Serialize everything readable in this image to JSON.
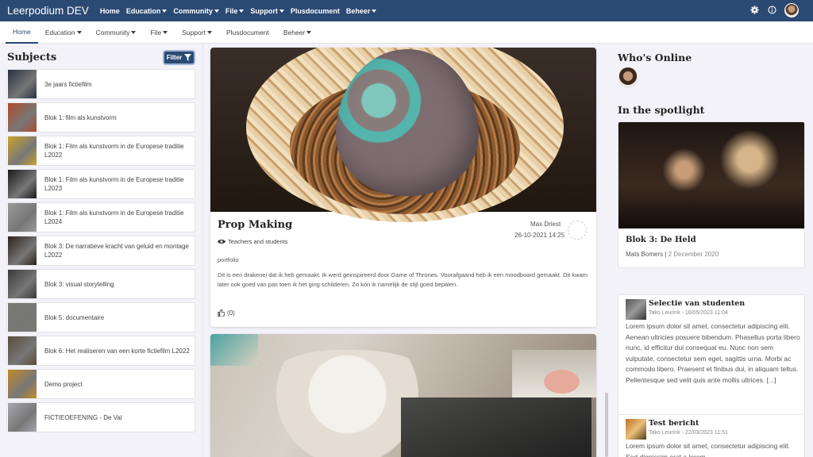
{
  "app": {
    "title": "Leerpodium DEV"
  },
  "topnav": {
    "items": [
      {
        "label": "Home",
        "has_caret": false
      },
      {
        "label": "Education",
        "has_caret": true
      },
      {
        "label": "Community",
        "has_caret": true
      },
      {
        "label": "File",
        "has_caret": true
      },
      {
        "label": "Support",
        "has_caret": true
      },
      {
        "label": "Plusdocument",
        "has_caret": false
      },
      {
        "label": "Beheer",
        "has_caret": true
      }
    ],
    "icons": [
      "gear-icon",
      "info-icon",
      "user-avatar"
    ]
  },
  "subnav": {
    "items": [
      {
        "label": "Home",
        "active": true
      },
      {
        "label": "Education",
        "has_caret": true
      },
      {
        "label": "Community",
        "has_caret": true
      },
      {
        "label": "File",
        "has_caret": true
      },
      {
        "label": "Support",
        "has_caret": true
      },
      {
        "label": "Plusdocument"
      },
      {
        "label": "Beheer",
        "has_caret": true
      }
    ]
  },
  "subjects": {
    "title": "Subjects",
    "filter_label": "Filter",
    "items": [
      {
        "label": "3e jaars fictiefilm",
        "color": "#2a3140"
      },
      {
        "label": "Blok 1: film als kunstvorm",
        "color": "#b04a2a"
      },
      {
        "label": "Blok 1: Film als kunstvorm in de Europese traditie L2022",
        "color": "#c9a32a"
      },
      {
        "label": "Blok 1: Film als kunstvorm in de Europese traditie L2023",
        "color": "#1a1a1a"
      },
      {
        "label": "Blok 1: Film als kunstvorm in de Europese traditie L2024",
        "color": "#9a9a9a"
      },
      {
        "label": "Blok 3: De narratieve kracht van geluid en montage L2022",
        "color": "#2b2218"
      },
      {
        "label": "Blok 3: visual storytelling",
        "color": "#3a3a3a"
      },
      {
        "label": "Blok 5: documentaire",
        "color": "#7a7a70"
      },
      {
        "label": "Blok 6: Het realiseren van een korte fictiefilm L2022",
        "color": "#5a4a3a"
      },
      {
        "label": "Demo project",
        "color": "#c48a2a"
      },
      {
        "label": "FICTIEOEFENING - De Val",
        "color": "#aaa6b0"
      }
    ]
  },
  "post": {
    "title": "Prop Making",
    "author": "Max Driest",
    "date": "26-10-2021 14:25",
    "audience": "Teachers and students",
    "tag": "portfolio",
    "body": "Dit is een drakenei dat ik heb gemaakt. Ik werd geinspireerd door Game of Thrones. Voorafgaand heb ik een moodboard gemaakt. Dit kwam later ook goed van pas toen ik het ging schilderen. Zo kon ik namelijk de stijl goed bepalen.",
    "likes": "(0)"
  },
  "sidebar": {
    "whos_online_title": "Who's Online",
    "spotlight_title": "In the spotlight",
    "spotlight": {
      "title": "Blok 3: De Held",
      "author": "Mats Bomers",
      "separator": "|",
      "date": "2 December 2020"
    },
    "feed": [
      {
        "title": "Selectie van studenten",
        "meta": "Tako Leurink - 16/05/2023 11:04",
        "text": "Lorem ipsum dolor sit amet, consectetur adipiscing elit. Aenean ultricies posuere bibendum. Phasellus porta libero nunc, id efficitur dui consequat eu. Nunc non sem vulputate, consectetur sem eget, sagittis urna. Morbi ac commodo libero. Praesent et finibus dui, in aliquam tellus. Pellentesque sed velit quis ante mollis ultrices. [...]"
      },
      {
        "title": "Test bericht",
        "meta": "Tako Leurink - 22/03/2023 11:51",
        "text": "Lorem ipsum dolor sit amet, consectetur adipiscing elit. Sed dignissim erat a lorem"
      }
    ]
  },
  "colors": {
    "brand": "#2b4a73",
    "background": "#f3f2f8"
  }
}
